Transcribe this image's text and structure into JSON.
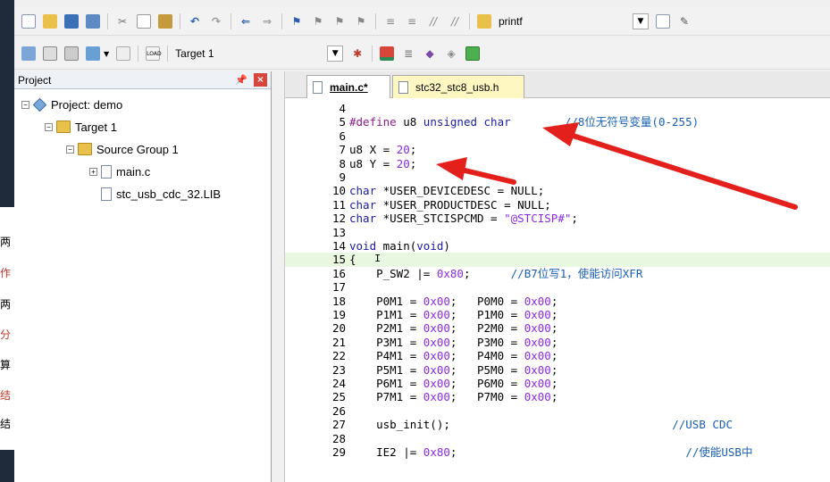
{
  "background_window": {
    "glyphs": [
      "两",
      "作",
      "两",
      "分",
      "算",
      "结",
      "结"
    ]
  },
  "toolbar1": {
    "find_text": "printf"
  },
  "toolbar2": {
    "target": "Target 1"
  },
  "project_panel": {
    "title": "Project",
    "tree": [
      {
        "label": "Project: demo",
        "type": "project"
      },
      {
        "label": "Target 1",
        "type": "target"
      },
      {
        "label": "Source Group 1",
        "type": "folder"
      },
      {
        "label": "main.c",
        "type": "file"
      },
      {
        "label": "stc_usb_cdc_32.LIB",
        "type": "file"
      }
    ]
  },
  "editor": {
    "tabs": [
      {
        "label": "main.c*",
        "active": true
      },
      {
        "label": "stc32_stc8_usb.h",
        "active": false
      }
    ],
    "lines": [
      {
        "n": "4",
        "parts": []
      },
      {
        "n": "5",
        "parts": [
          [
            "pp",
            "#define "
          ],
          [
            "",
            "u8 "
          ],
          [
            "kw",
            "unsigned char"
          ],
          [
            "",
            "        "
          ],
          [
            "cm",
            "//8位无符号变量(0-255)"
          ]
        ]
      },
      {
        "n": "6",
        "parts": []
      },
      {
        "n": "7",
        "parts": [
          [
            "",
            "u8 X = "
          ],
          [
            "num",
            "20"
          ],
          [
            "",
            ";"
          ]
        ]
      },
      {
        "n": "8",
        "parts": [
          [
            "",
            "u8 Y = "
          ],
          [
            "num",
            "20"
          ],
          [
            "",
            ";"
          ]
        ]
      },
      {
        "n": "9",
        "parts": []
      },
      {
        "n": "10",
        "parts": [
          [
            "kw",
            "char"
          ],
          [
            "",
            " *USER_DEVICEDESC = NULL;"
          ]
        ]
      },
      {
        "n": "11",
        "parts": [
          [
            "kw",
            "char"
          ],
          [
            "",
            " *USER_PRODUCTDESC = NULL;"
          ]
        ]
      },
      {
        "n": "12",
        "parts": [
          [
            "kw",
            "char"
          ],
          [
            "",
            " *USER_STCISPCMD = "
          ],
          [
            "str",
            "\"@STCISP#\""
          ],
          [
            "",
            ";"
          ]
        ]
      },
      {
        "n": "13",
        "parts": []
      },
      {
        "n": "14",
        "parts": [
          [
            "kw",
            "void"
          ],
          [
            "",
            " main("
          ],
          [
            "kw",
            "void"
          ],
          [
            "",
            ")"
          ]
        ]
      },
      {
        "n": "15",
        "parts": [
          [
            "",
            "{"
          ]
        ],
        "highlight": true
      },
      {
        "n": "16",
        "parts": [
          [
            "",
            "    P_SW2 |= "
          ],
          [
            "num",
            "0x80"
          ],
          [
            "",
            ";      "
          ],
          [
            "cm",
            "//B7位写1，使能访问XFR"
          ]
        ]
      },
      {
        "n": "17",
        "parts": []
      },
      {
        "n": "18",
        "parts": [
          [
            "",
            "    P0M1 = "
          ],
          [
            "num",
            "0x00"
          ],
          [
            "",
            ";   P0M0 = "
          ],
          [
            "num",
            "0x00"
          ],
          [
            "",
            ";"
          ]
        ]
      },
      {
        "n": "19",
        "parts": [
          [
            "",
            "    P1M1 = "
          ],
          [
            "num",
            "0x00"
          ],
          [
            "",
            ";   P1M0 = "
          ],
          [
            "num",
            "0x00"
          ],
          [
            "",
            ";"
          ]
        ]
      },
      {
        "n": "20",
        "parts": [
          [
            "",
            "    P2M1 = "
          ],
          [
            "num",
            "0x00"
          ],
          [
            "",
            ";   P2M0 = "
          ],
          [
            "num",
            "0x00"
          ],
          [
            "",
            ";"
          ]
        ]
      },
      {
        "n": "21",
        "parts": [
          [
            "",
            "    P3M1 = "
          ],
          [
            "num",
            "0x00"
          ],
          [
            "",
            ";   P3M0 = "
          ],
          [
            "num",
            "0x00"
          ],
          [
            "",
            ";"
          ]
        ]
      },
      {
        "n": "22",
        "parts": [
          [
            "",
            "    P4M1 = "
          ],
          [
            "num",
            "0x00"
          ],
          [
            "",
            ";   P4M0 = "
          ],
          [
            "num",
            "0x00"
          ],
          [
            "",
            ";"
          ]
        ]
      },
      {
        "n": "23",
        "parts": [
          [
            "",
            "    P5M1 = "
          ],
          [
            "num",
            "0x00"
          ],
          [
            "",
            ";   P5M0 = "
          ],
          [
            "num",
            "0x00"
          ],
          [
            "",
            ";"
          ]
        ]
      },
      {
        "n": "24",
        "parts": [
          [
            "",
            "    P6M1 = "
          ],
          [
            "num",
            "0x00"
          ],
          [
            "",
            ";   P6M0 = "
          ],
          [
            "num",
            "0x00"
          ],
          [
            "",
            ";"
          ]
        ]
      },
      {
        "n": "25",
        "parts": [
          [
            "",
            "    P7M1 = "
          ],
          [
            "num",
            "0x00"
          ],
          [
            "",
            ";   P7M0 = "
          ],
          [
            "num",
            "0x00"
          ],
          [
            "",
            ";"
          ]
        ]
      },
      {
        "n": "26",
        "parts": []
      },
      {
        "n": "27",
        "parts": [
          [
            "",
            "    usb_init();                                 "
          ],
          [
            "cm",
            "//USB CDC"
          ]
        ]
      },
      {
        "n": "28",
        "parts": []
      },
      {
        "n": "29",
        "parts": [
          [
            "",
            "    IE2 |= "
          ],
          [
            "num",
            "0x80"
          ],
          [
            "",
            ";                                  "
          ],
          [
            "cm",
            "//使能USB中"
          ]
        ]
      }
    ]
  },
  "colors": {
    "annotation_arrow": "#e3201b",
    "current_line": "#e8f7e0"
  }
}
